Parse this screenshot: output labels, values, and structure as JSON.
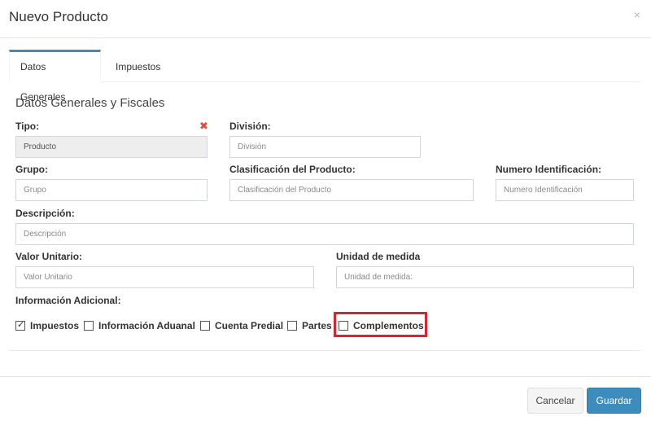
{
  "modal": {
    "title": "Nuevo Producto",
    "close_glyph": "×"
  },
  "tabs": [
    {
      "label": "Datos Generales",
      "active": true
    },
    {
      "label": "Impuestos",
      "active": false
    }
  ],
  "section_title": "Datos Generales y Fiscales",
  "fields": {
    "tipo": {
      "label": "Tipo:",
      "value": "Producto",
      "disabled": true
    },
    "division": {
      "label": "División:",
      "placeholder": "División"
    },
    "grupo": {
      "label": "Grupo:",
      "placeholder": "Grupo"
    },
    "clasificacion": {
      "label": "Clasificación del Producto:",
      "placeholder": "Clasificación del Producto"
    },
    "numero_identificacion": {
      "label": "Numero Identificación:",
      "placeholder": "Numero Identificación"
    },
    "descripcion": {
      "label": "Descripción:",
      "placeholder": "Descripción"
    },
    "valor_unitario": {
      "label": "Valor Unitario:",
      "placeholder": "Valor Unitario"
    },
    "unidad_medida": {
      "label": "Unidad de medida",
      "placeholder": "Unidad de medida:"
    }
  },
  "required_icon": "✖",
  "info_adicional": {
    "label": "Información Adicional:",
    "options": [
      {
        "label": "Impuestos",
        "checked": true
      },
      {
        "label": "Información Aduanal",
        "checked": false
      },
      {
        "label": "Cuenta Predial",
        "checked": false
      },
      {
        "label": "Partes",
        "checked": false
      },
      {
        "label": "Complementos",
        "checked": false
      }
    ],
    "check_glyph": "✓"
  },
  "buttons": {
    "cancel": "Cancelar",
    "save": "Guardar"
  },
  "colors": {
    "primary": "#3c8dbc",
    "highlight": "#d9232e",
    "required": "#dd4b39"
  }
}
